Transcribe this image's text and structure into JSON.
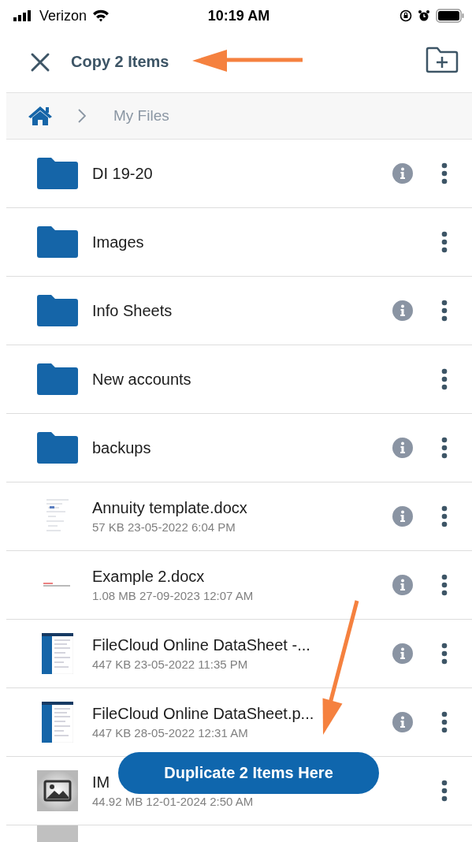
{
  "status_bar": {
    "carrier": "Verizon",
    "time": "10:19 AM"
  },
  "header": {
    "title": "Copy 2 Items"
  },
  "breadcrumb": {
    "items": [
      "My Files"
    ]
  },
  "rows": [
    {
      "kind": "folder",
      "name": "DI 19-20",
      "info": true
    },
    {
      "kind": "folder",
      "name": "Images",
      "info": false
    },
    {
      "kind": "folder",
      "name": "Info Sheets",
      "info": true
    },
    {
      "kind": "folder",
      "name": "New accounts",
      "info": false
    },
    {
      "kind": "folder",
      "name": "backups",
      "info": true
    },
    {
      "kind": "doc",
      "name": "Annuity template.docx",
      "meta": "57 KB 23-05-2022 6:04 PM",
      "info": true
    },
    {
      "kind": "doc2",
      "name": "Example 2.docx",
      "meta": "1.08 MB 27-09-2023 12:07 AM",
      "info": true
    },
    {
      "kind": "pdf",
      "name": "FileCloud Online DataSheet -...",
      "meta": "447 KB 23-05-2022 11:35 PM",
      "info": true
    },
    {
      "kind": "pdf",
      "name": "FileCloud Online DataSheet.p...",
      "meta": "447 KB 28-05-2022 12:31 AM",
      "info": true
    },
    {
      "kind": "image",
      "name": "IM",
      "meta": "44.92 MB 12-01-2024 2:50 AM",
      "info": false
    }
  ],
  "action_button": {
    "label": "Duplicate 2 Items Here"
  }
}
